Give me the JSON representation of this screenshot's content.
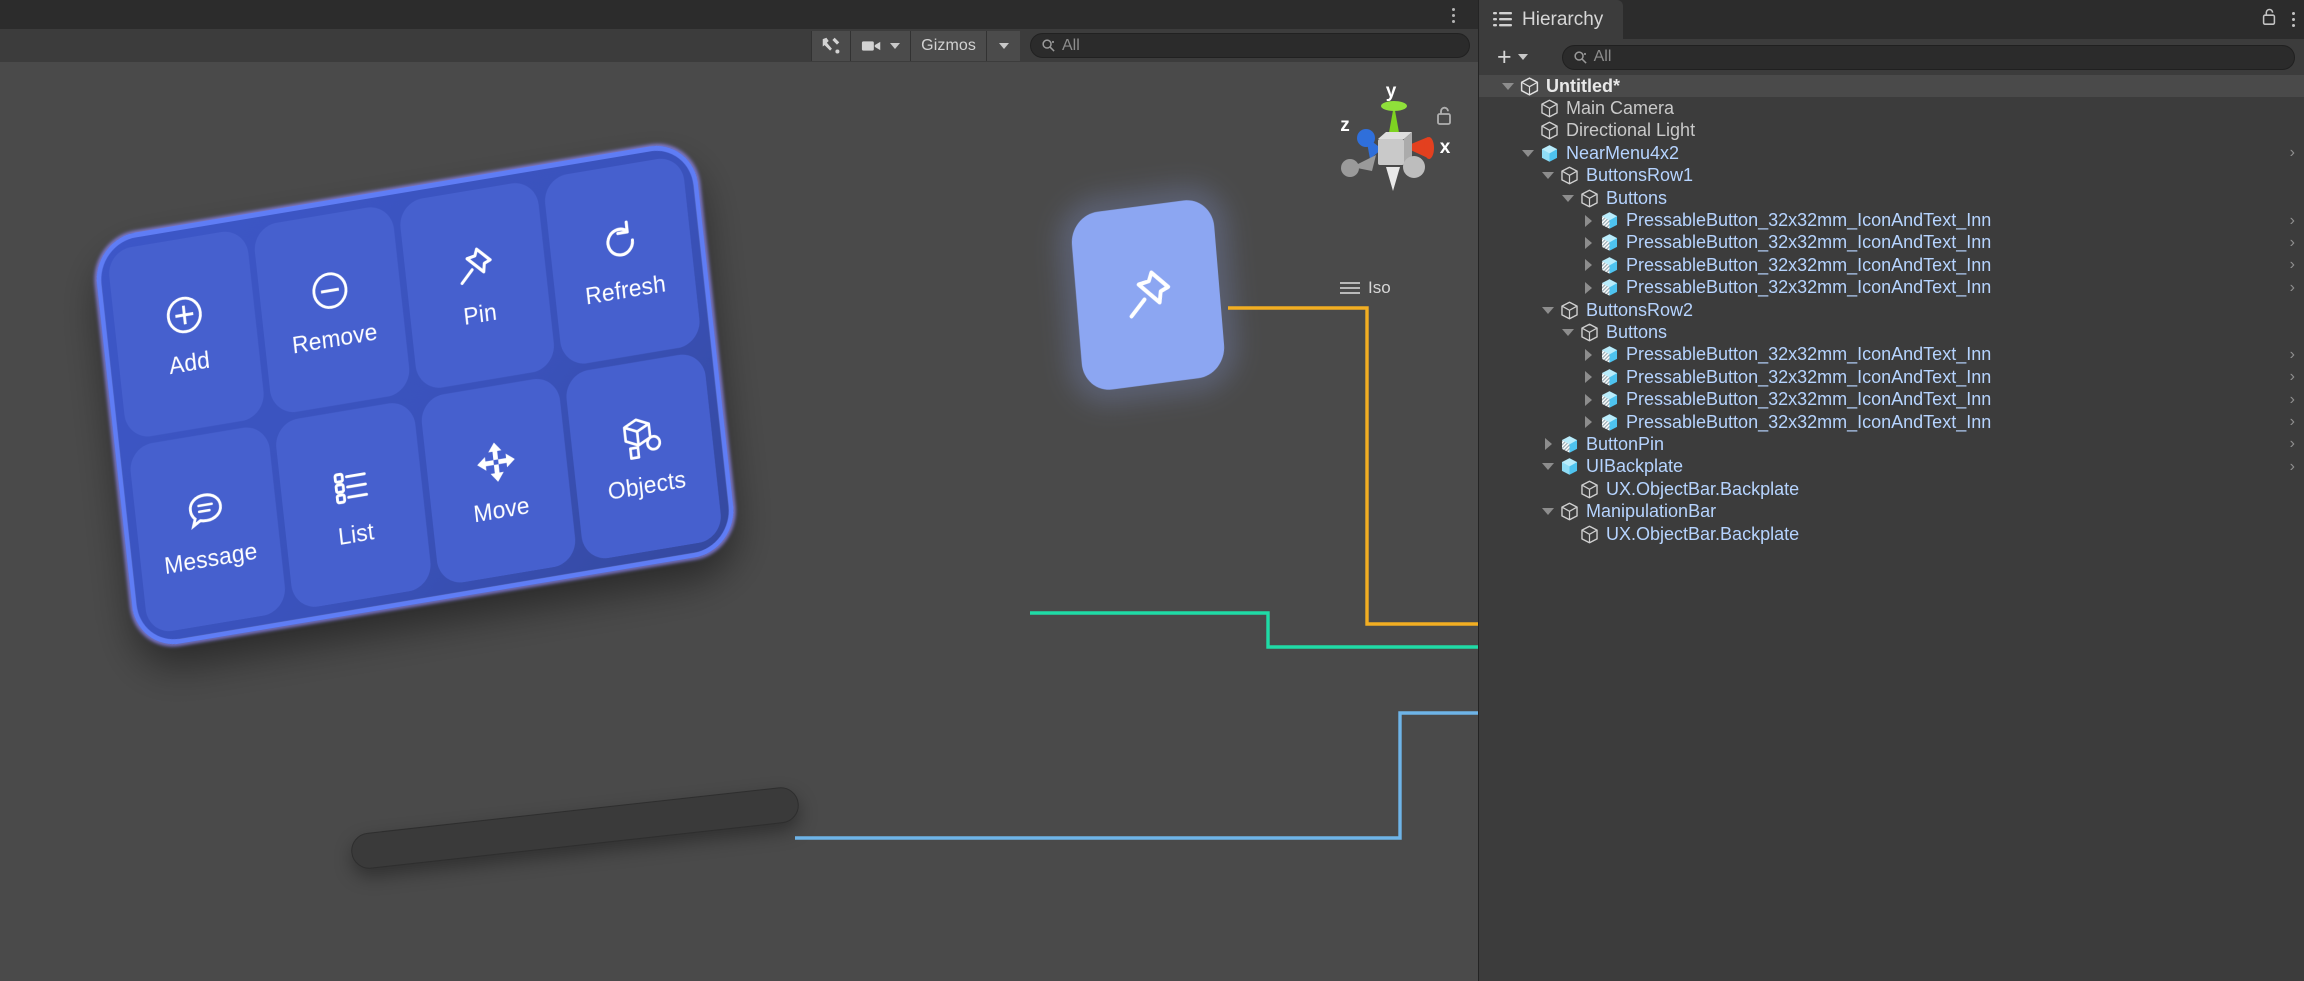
{
  "scene": {
    "toolbar": {
      "tools_icon": "wrench-screwdriver-icon",
      "camera_icon": "camera-icon",
      "gizmos_label": "Gizmos",
      "search_placeholder": "All",
      "search_value": "",
      "search_icon": "search-icon",
      "kebab_icon": "overflow-menu-icon"
    },
    "gizmo": {
      "axis_x": "x",
      "axis_y": "y",
      "axis_z": "z",
      "projection_label": "Iso",
      "lock_icon": "unlocked-padlock-icon",
      "menu_icon": "hamburger-icon",
      "colors": {
        "x": "#e3401f",
        "y": "#7ed321",
        "z": "#2f6fdb",
        "center": "#c9c9c9"
      }
    },
    "near_menu": {
      "name": "NearMenu4x2",
      "buttons": [
        {
          "label": "Add",
          "icon": "plus-circle-icon"
        },
        {
          "label": "Remove",
          "icon": "minus-circle-icon"
        },
        {
          "label": "Pin",
          "icon": "pushpin-icon"
        },
        {
          "label": "Refresh",
          "icon": "refresh-arrow-icon"
        },
        {
          "label": "Message",
          "icon": "chat-bubble-icon"
        },
        {
          "label": "List",
          "icon": "bulleted-list-icon"
        },
        {
          "label": "Move",
          "icon": "four-way-move-arrows-icon"
        },
        {
          "label": "Objects",
          "icon": "stacked-cubes-icon"
        }
      ],
      "plate_color": "#3a52bb",
      "button_color": "#4660ce",
      "border_color": "#5f7df5"
    },
    "floating_pin": {
      "icon": "pushpin-icon",
      "face_color": "#8ca6f2"
    },
    "manipulation_bar": {
      "color": "#3a3a3a"
    },
    "connectors": [
      {
        "name": "pin-connector",
        "color": "#f2ae22"
      },
      {
        "name": "backplate-connector",
        "color": "#1fdba6"
      },
      {
        "name": "manipulation-connector",
        "color": "#6eb4e8"
      }
    ]
  },
  "hierarchy": {
    "tab_label": "Hierarchy",
    "tab_icon": "hierarchy-list-icon",
    "lock_icon": "unlocked-padlock-icon",
    "kebab_icon": "overflow-menu-icon",
    "add_label": "+",
    "add_icon": "plus-icon",
    "add_caret_icon": "chevron-down-icon",
    "search_placeholder": "All",
    "search_value": "",
    "search_icon": "search-icon",
    "rows": [
      {
        "label": "Untitled*",
        "depth": 1,
        "twisty": "down",
        "icon": "unity-scene-icon",
        "style": "root",
        "selected": true,
        "chevron": false,
        "kebab": true,
        "wire": null
      },
      {
        "label": "Main Camera",
        "depth": 2,
        "twisty": "none",
        "icon": "cube-outline-icon",
        "style": "plain",
        "selected": false,
        "chevron": false,
        "kebab": false,
        "wire": null
      },
      {
        "label": "Directional Light",
        "depth": 2,
        "twisty": "none",
        "icon": "cube-outline-icon",
        "style": "plain",
        "selected": false,
        "chevron": false,
        "kebab": false,
        "wire": null
      },
      {
        "label": "NearMenu4x2",
        "depth": 2,
        "twisty": "down",
        "icon": "prefab-cube-icon",
        "style": "prefab",
        "selected": false,
        "chevron": true,
        "kebab": false,
        "wire": null
      },
      {
        "label": "ButtonsRow1",
        "depth": 3,
        "twisty": "down",
        "icon": "cube-outline-icon",
        "style": "link",
        "selected": false,
        "chevron": false,
        "kebab": false,
        "wire": null
      },
      {
        "label": "Buttons",
        "depth": 4,
        "twisty": "down",
        "icon": "cube-outline-icon",
        "style": "link",
        "selected": false,
        "chevron": false,
        "kebab": false,
        "wire": null
      },
      {
        "label": "PressableButton_32x32mm_IconAndText_Inn",
        "depth": 5,
        "twisty": "right",
        "icon": "prefab-variant-icon",
        "style": "link",
        "selected": false,
        "chevron": true,
        "kebab": false,
        "wire": null
      },
      {
        "label": "PressableButton_32x32mm_IconAndText_Inn",
        "depth": 5,
        "twisty": "right",
        "icon": "prefab-variant-icon",
        "style": "link",
        "selected": false,
        "chevron": true,
        "kebab": false,
        "wire": null
      },
      {
        "label": "PressableButton_32x32mm_IconAndText_Inn",
        "depth": 5,
        "twisty": "right",
        "icon": "prefab-variant-icon",
        "style": "link",
        "selected": false,
        "chevron": true,
        "kebab": false,
        "wire": null
      },
      {
        "label": "PressableButton_32x32mm_IconAndText_Inn",
        "depth": 5,
        "twisty": "right",
        "icon": "prefab-variant-icon",
        "style": "link",
        "selected": false,
        "chevron": true,
        "kebab": false,
        "wire": null
      },
      {
        "label": "ButtonsRow2",
        "depth": 3,
        "twisty": "down",
        "icon": "cube-outline-icon",
        "style": "link",
        "selected": false,
        "chevron": false,
        "kebab": false,
        "wire": null
      },
      {
        "label": "Buttons",
        "depth": 4,
        "twisty": "down",
        "icon": "cube-outline-icon",
        "style": "link",
        "selected": false,
        "chevron": false,
        "kebab": false,
        "wire": null
      },
      {
        "label": "PressableButton_32x32mm_IconAndText_Inn",
        "depth": 5,
        "twisty": "right",
        "icon": "prefab-variant-icon",
        "style": "link",
        "selected": false,
        "chevron": true,
        "kebab": false,
        "wire": null
      },
      {
        "label": "PressableButton_32x32mm_IconAndText_Inn",
        "depth": 5,
        "twisty": "right",
        "icon": "prefab-variant-icon",
        "style": "link",
        "selected": false,
        "chevron": true,
        "kebab": false,
        "wire": null
      },
      {
        "label": "PressableButton_32x32mm_IconAndText_Inn",
        "depth": 5,
        "twisty": "right",
        "icon": "prefab-variant-icon",
        "style": "link",
        "selected": false,
        "chevron": true,
        "kebab": false,
        "wire": null
      },
      {
        "label": "PressableButton_32x32mm_IconAndText_Inn",
        "depth": 5,
        "twisty": "right",
        "icon": "prefab-variant-icon",
        "style": "link",
        "selected": false,
        "chevron": true,
        "kebab": false,
        "wire": null
      },
      {
        "label": "ButtonPin",
        "depth": 3,
        "twisty": "right",
        "icon": "prefab-variant-icon",
        "style": "link",
        "selected": false,
        "chevron": true,
        "kebab": false,
        "wire": "#f2ae22"
      },
      {
        "label": "UIBackplate",
        "depth": 3,
        "twisty": "down",
        "icon": "prefab-cube-icon",
        "style": "link",
        "selected": false,
        "chevron": true,
        "kebab": false,
        "wire": "#1fdba6"
      },
      {
        "label": "UX.ObjectBar.Backplate",
        "depth": 4,
        "twisty": "none",
        "icon": "cube-outline-icon",
        "style": "link",
        "selected": false,
        "chevron": false,
        "kebab": false,
        "wire": null
      },
      {
        "label": "ManipulationBar",
        "depth": 3,
        "twisty": "down",
        "icon": "cube-outline-icon",
        "style": "link",
        "selected": false,
        "chevron": false,
        "kebab": false,
        "wire": "#6eb4e8"
      },
      {
        "label": "UX.ObjectBar.Backplate",
        "depth": 4,
        "twisty": "none",
        "icon": "cube-outline-icon",
        "style": "link",
        "selected": false,
        "chevron": false,
        "kebab": false,
        "wire": null
      }
    ]
  }
}
